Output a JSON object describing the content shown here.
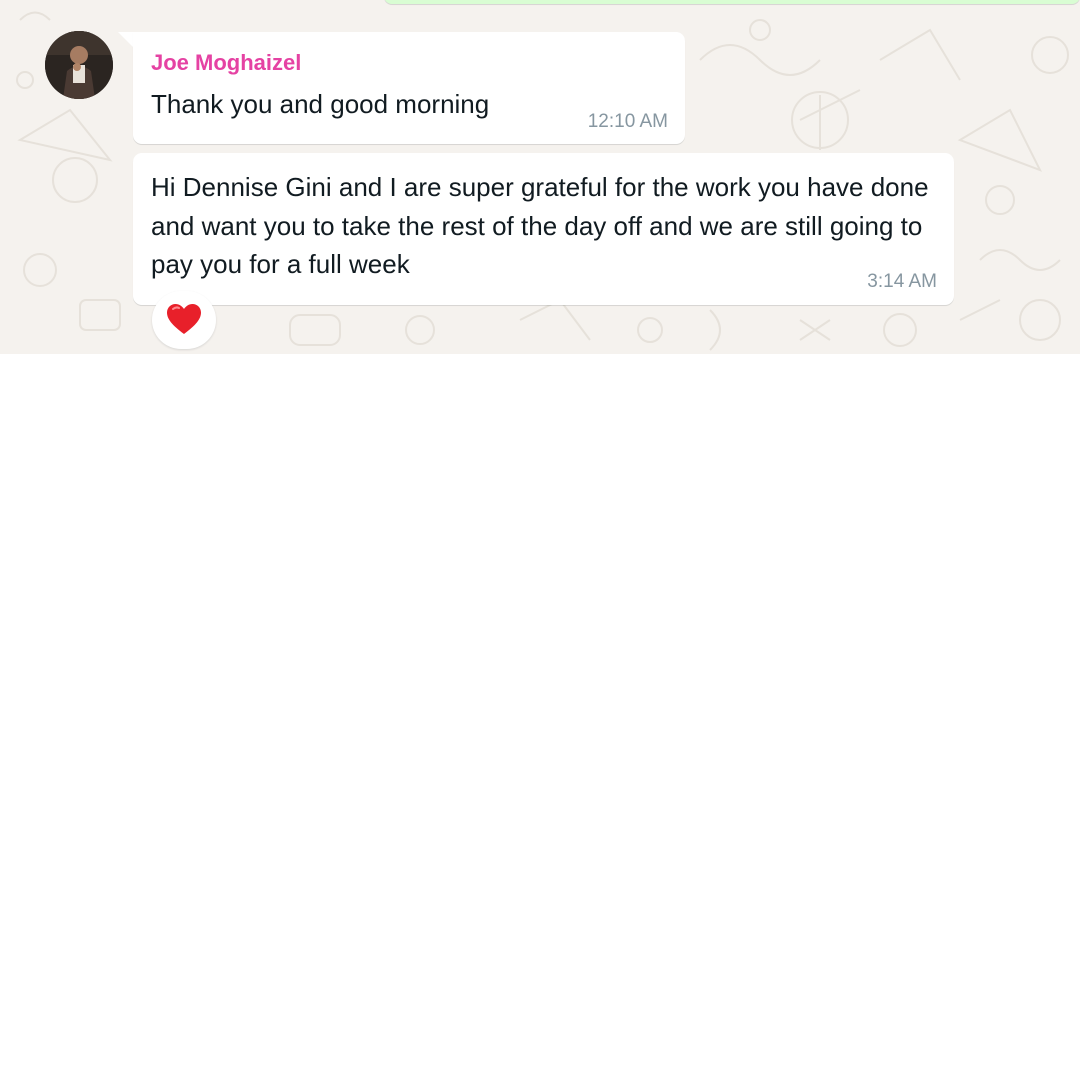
{
  "messages": [
    {
      "sender": "Joe Moghaizel",
      "text": "Thank you and good morning",
      "time": "12:10 AM"
    },
    {
      "text": "Hi Dennise Gini and I are super grateful for the work you have done and want you to take the rest of the day off and we are still going to pay you for a full week",
      "time": "3:14 AM",
      "reaction": "heart"
    }
  ],
  "colors": {
    "sender_name": "#e542a3",
    "chat_background": "#f5f2ee",
    "bubble": "#ffffff",
    "outgoing_bubble": "#d9fdd3",
    "timestamp": "#8696a0",
    "text": "#111b21",
    "reaction_heart": "#e8202a"
  },
  "icons": {
    "avatar": "contact-photo",
    "reaction": "red-heart-emoji"
  }
}
